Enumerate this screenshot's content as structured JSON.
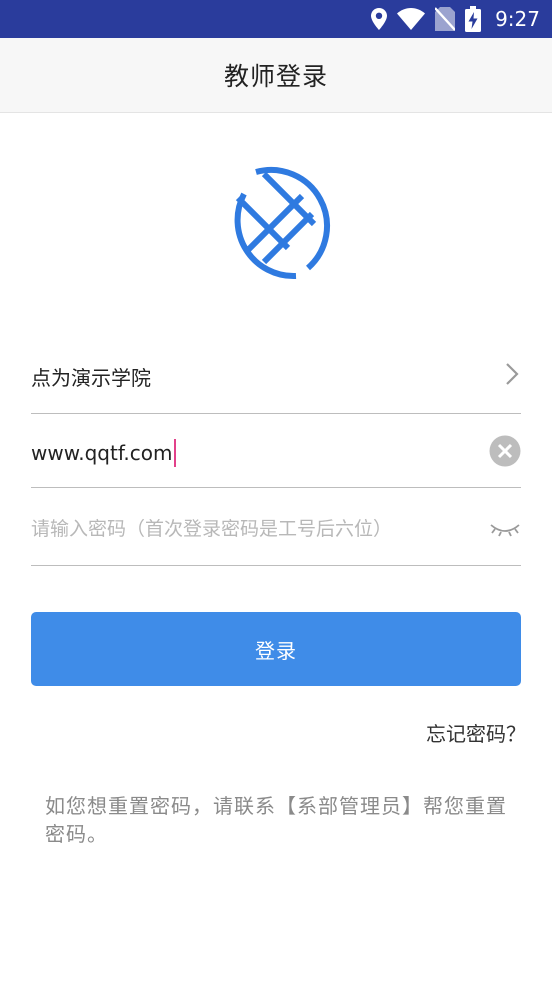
{
  "status_bar": {
    "time": "9:27",
    "icons": [
      "location-icon",
      "wifi-icon",
      "no-sim-icon",
      "battery-charging-icon"
    ],
    "background": "#2a3c9c"
  },
  "header": {
    "title": "教师登录"
  },
  "logo": {
    "icon": "brand-logo-icon",
    "color": "#2f7ae0"
  },
  "form": {
    "school": {
      "value": "点为演示学院",
      "icon": "chevron-right-icon"
    },
    "account": {
      "value": "www.qqtf.com",
      "icon": "clear-icon"
    },
    "password": {
      "placeholder": "请输入密码（首次登录密码是工号后六位）",
      "icon": "eye-closed-icon"
    }
  },
  "login_button": {
    "label": "登录",
    "color": "#3f8ce8"
  },
  "forgot_link": {
    "label": "忘记密码？"
  },
  "hint": {
    "text": "如您想重置密码，请联系【系部管理员】帮您重置密码。"
  }
}
